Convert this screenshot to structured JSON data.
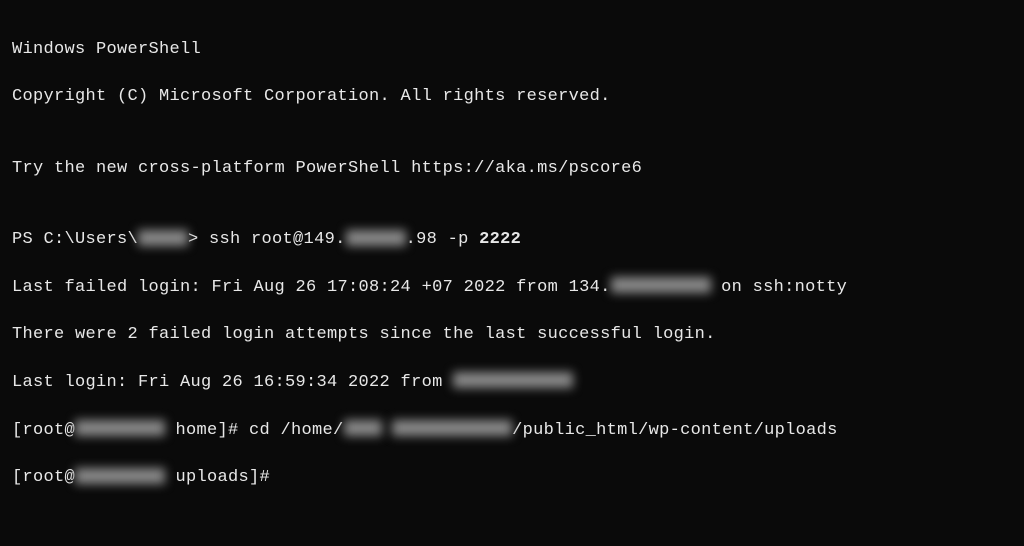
{
  "header": {
    "title": "Windows PowerShell",
    "copyright": "Copyright (C) Microsoft Corporation. All rights reserved.",
    "try_text": "Try the new cross-platform PowerShell https://aka.ms/pscore6"
  },
  "prompt1": {
    "prefix": "PS C:\\Users\\",
    "redacted_user": "████",
    "arrow": "> ",
    "cmd_ssh": "ssh root@149.",
    "redacted_ip": "██ ██",
    "ip_suffix": ".98 -p ",
    "port": "2222"
  },
  "login_info": {
    "last_failed_prefix": "Last failed login: Fri Aug 26 17:08:24 +07 2022 from 134.",
    "redacted_from_ip": "██ ███ ██",
    "on_suffix": " on ssh:notty",
    "attempts": "There were 2 failed login attempts since the last successful login.",
    "last_login_prefix": "Last login: Fri Aug 26 16:59:34 2022 from ",
    "redacted_last_ip": "█████████"
  },
  "prompt2": {
    "root_open": "[root@",
    "redacted_host": "██████",
    "home_bracket": " home]# ",
    "cd_cmd": "cd /home/",
    "redacted_path1": "███",
    "redacted_path2": "████████",
    "path_suffix": "/public_html/wp-content/uploads"
  },
  "prompt3": {
    "root_open": "[root@",
    "redacted_host": "██████",
    "uploads_bracket": " uploads]#"
  }
}
